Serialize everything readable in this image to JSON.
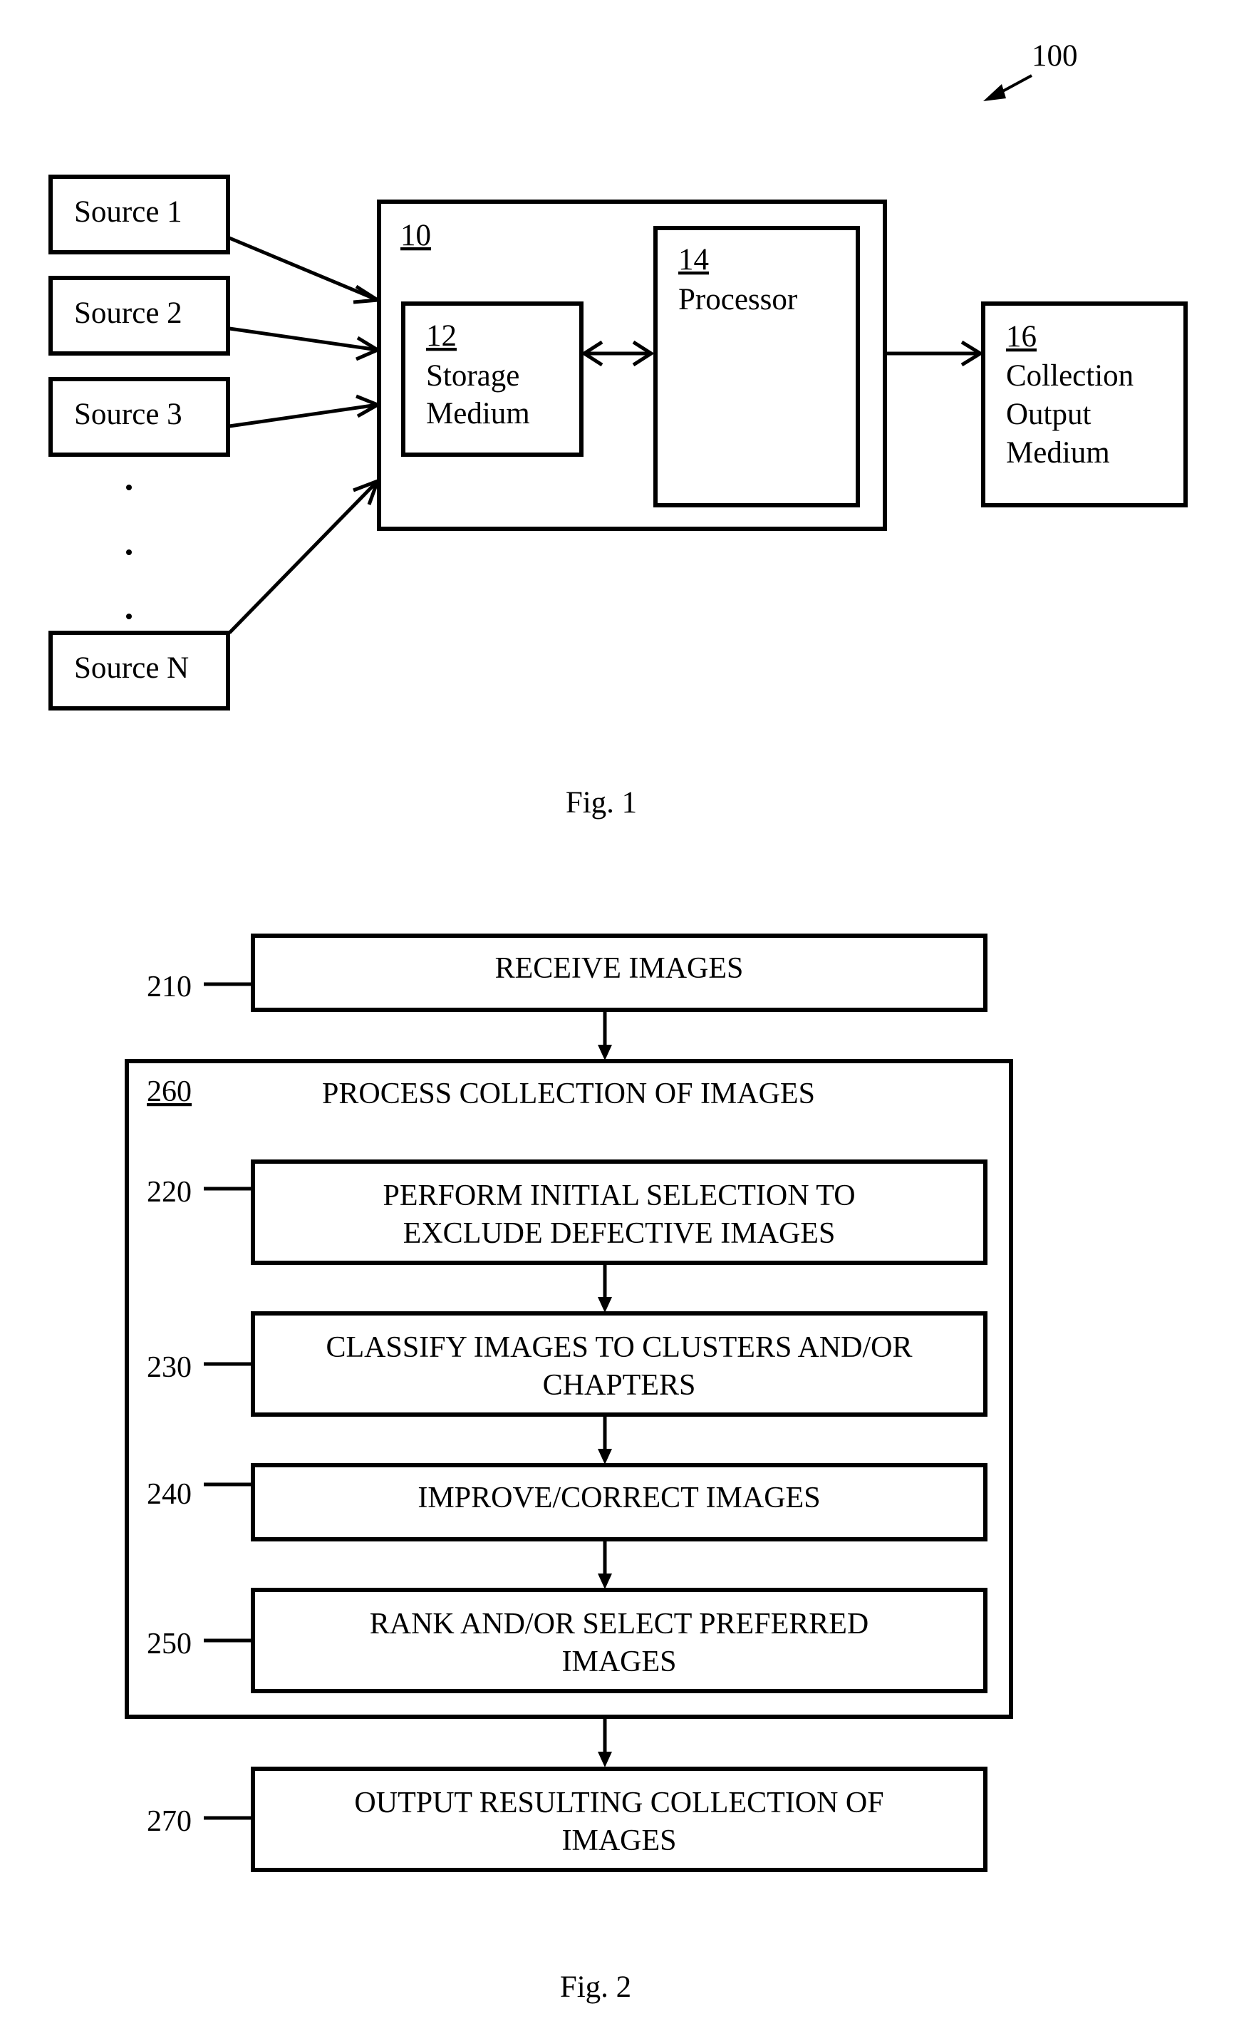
{
  "fig1": {
    "caption": "Fig. 1",
    "system_ref": "100",
    "device": {
      "ref": "10"
    },
    "storage": {
      "ref": "12",
      "lines": [
        "Storage",
        "Medium"
      ]
    },
    "processor": {
      "ref": "14",
      "lines": [
        "Processor"
      ]
    },
    "output": {
      "ref": "16",
      "lines": [
        "Collection",
        "Output",
        "Medium"
      ]
    },
    "sources": [
      "Source 1",
      "Source 2",
      "Source 3",
      "Source N"
    ],
    "ellipsis": "· · ·"
  },
  "fig2": {
    "caption": "Fig. 2",
    "container": {
      "ref": "260",
      "title": "PROCESS COLLECTION OF IMAGES"
    },
    "steps": [
      {
        "ref": "210",
        "lines": [
          "RECEIVE IMAGES"
        ]
      },
      {
        "ref": "220",
        "lines": [
          "PERFORM INITIAL SELECTION TO",
          "EXCLUDE DEFECTIVE IMAGES"
        ]
      },
      {
        "ref": "230",
        "lines": [
          "CLASSIFY IMAGES TO CLUSTERS AND/OR",
          "CHAPTERS"
        ]
      },
      {
        "ref": "240",
        "lines": [
          "IMPROVE/CORRECT IMAGES"
        ]
      },
      {
        "ref": "250",
        "lines": [
          "RANK AND/OR SELECT PREFERRED",
          "IMAGES"
        ]
      },
      {
        "ref": "270",
        "lines": [
          "OUTPUT RESULTING COLLECTION OF",
          "IMAGES"
        ]
      }
    ]
  }
}
